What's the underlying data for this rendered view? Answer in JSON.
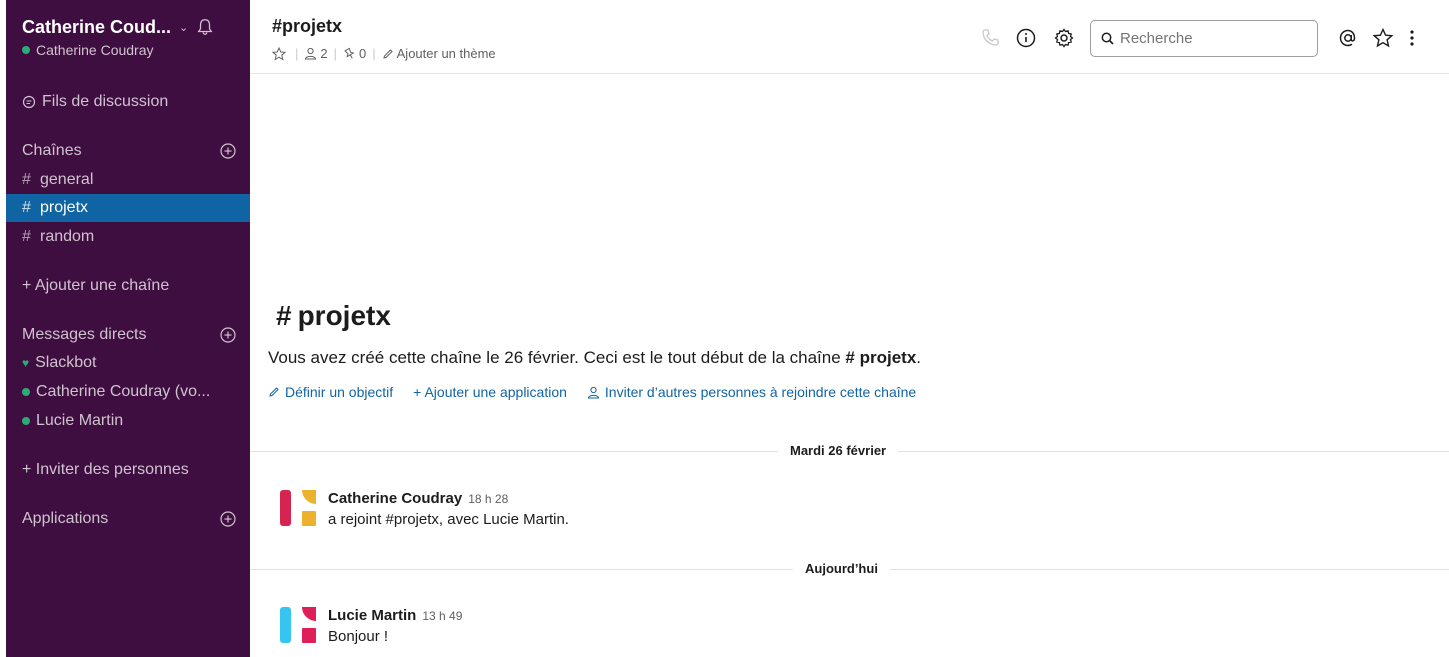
{
  "workspace": {
    "name": "Catherine Coud...",
    "user": "Catherine Coudray"
  },
  "sidebar": {
    "threads": "Fils de discussion",
    "channels_header": "Chaînes",
    "channels": [
      {
        "name": "general",
        "active": false
      },
      {
        "name": "projetx",
        "active": true
      },
      {
        "name": "random",
        "active": false
      }
    ],
    "add_channel": "+ Ajouter une chaîne",
    "dm_header": "Messages directs",
    "dms": [
      {
        "name": "Slackbot",
        "status": "heart"
      },
      {
        "name": "Catherine Coudray  (vo...",
        "status": "online"
      },
      {
        "name": "Lucie Martin",
        "status": "online"
      }
    ],
    "invite": "+ Inviter des personnes",
    "apps_header": "Applications"
  },
  "header": {
    "channel_title": "#projetx",
    "members_count": "2",
    "pins_count": "0",
    "add_topic": "Ajouter un thème",
    "search_placeholder": "Recherche"
  },
  "intro": {
    "hash": "#",
    "title": "projetx",
    "text_prefix": "Vous avez créé cette chaîne le 26 février. Ceci est le tout début de la chaîne ",
    "text_channel": "# projetx",
    "text_suffix": ".",
    "link_objective": "Définir un objectif",
    "link_app": "+ Ajouter une application",
    "link_invite": "Inviter d’autres personnes à rejoindre cette chaîne"
  },
  "dividers": [
    "Mardi 26 février",
    "Aujourd’hui"
  ],
  "messages": [
    {
      "author": "Catherine Coudray",
      "time": "18 h 28",
      "body": "a rejoint #projetx, avec Lucie Martin."
    },
    {
      "author": "Lucie Martin",
      "time": "13 h 49",
      "body": "Bonjour !"
    }
  ],
  "colors": {
    "sidebar_bg": "#3f0e40",
    "active_channel": "#1164a3",
    "presence": "#2bac76",
    "link": "#1264a3"
  }
}
